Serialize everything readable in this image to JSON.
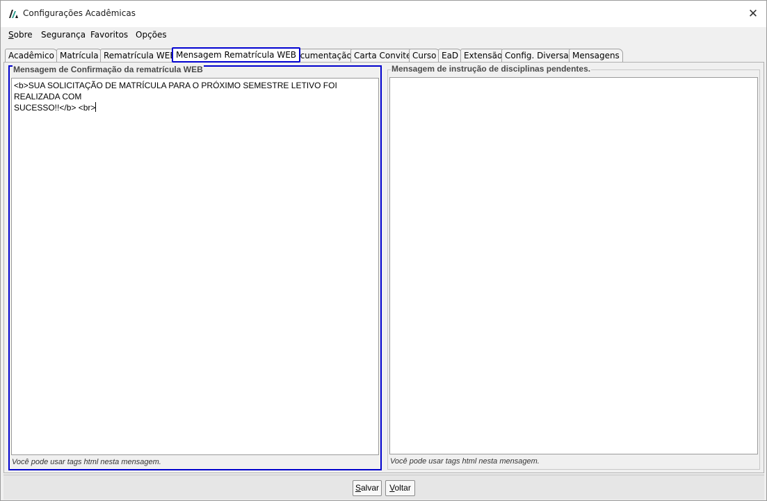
{
  "window": {
    "title": "Configurações Acadêmicas",
    "close_glyph": "✕"
  },
  "menu": {
    "items": [
      {
        "first": "S",
        "rest": "obre"
      },
      {
        "first": "",
        "rest": "Segurança"
      },
      {
        "first": "",
        "rest": "Favoritos"
      },
      {
        "first": "",
        "rest": "Opções"
      }
    ]
  },
  "tabs": [
    "Acadêmico",
    "Matrícula",
    "Rematrícula WEB",
    "Mensagem Rematrícula WEB",
    "Documentação",
    "Carta Convite",
    "Curso",
    "EaD",
    "Extensão",
    "Config. Diversas",
    "Mensagens"
  ],
  "active_tab": "Mensagem Rematrícula WEB",
  "left_group": {
    "title": "Mensagem de Confirmação da rematrícula WEB",
    "line1": "<b>SUA SOLICITAÇÃO DE MATRÍCULA PARA O PRÓXIMO SEMESTRE LETIVO FOI REALIZADA COM",
    "line2": "SUCESSO!!</b> <br>",
    "hint": "Você pode usar tags html nesta mensagem."
  },
  "right_group": {
    "title": "Mensagem de instrução de disciplinas pendentes.",
    "value": "",
    "hint": "Você pode usar tags html nesta mensagem."
  },
  "buttons": {
    "save_first": "S",
    "save_rest": "alvar",
    "back_first": "V",
    "back_rest": "oltar"
  },
  "colors": {
    "focus_border": "#0000cc",
    "logo": "#2a9d8f"
  }
}
